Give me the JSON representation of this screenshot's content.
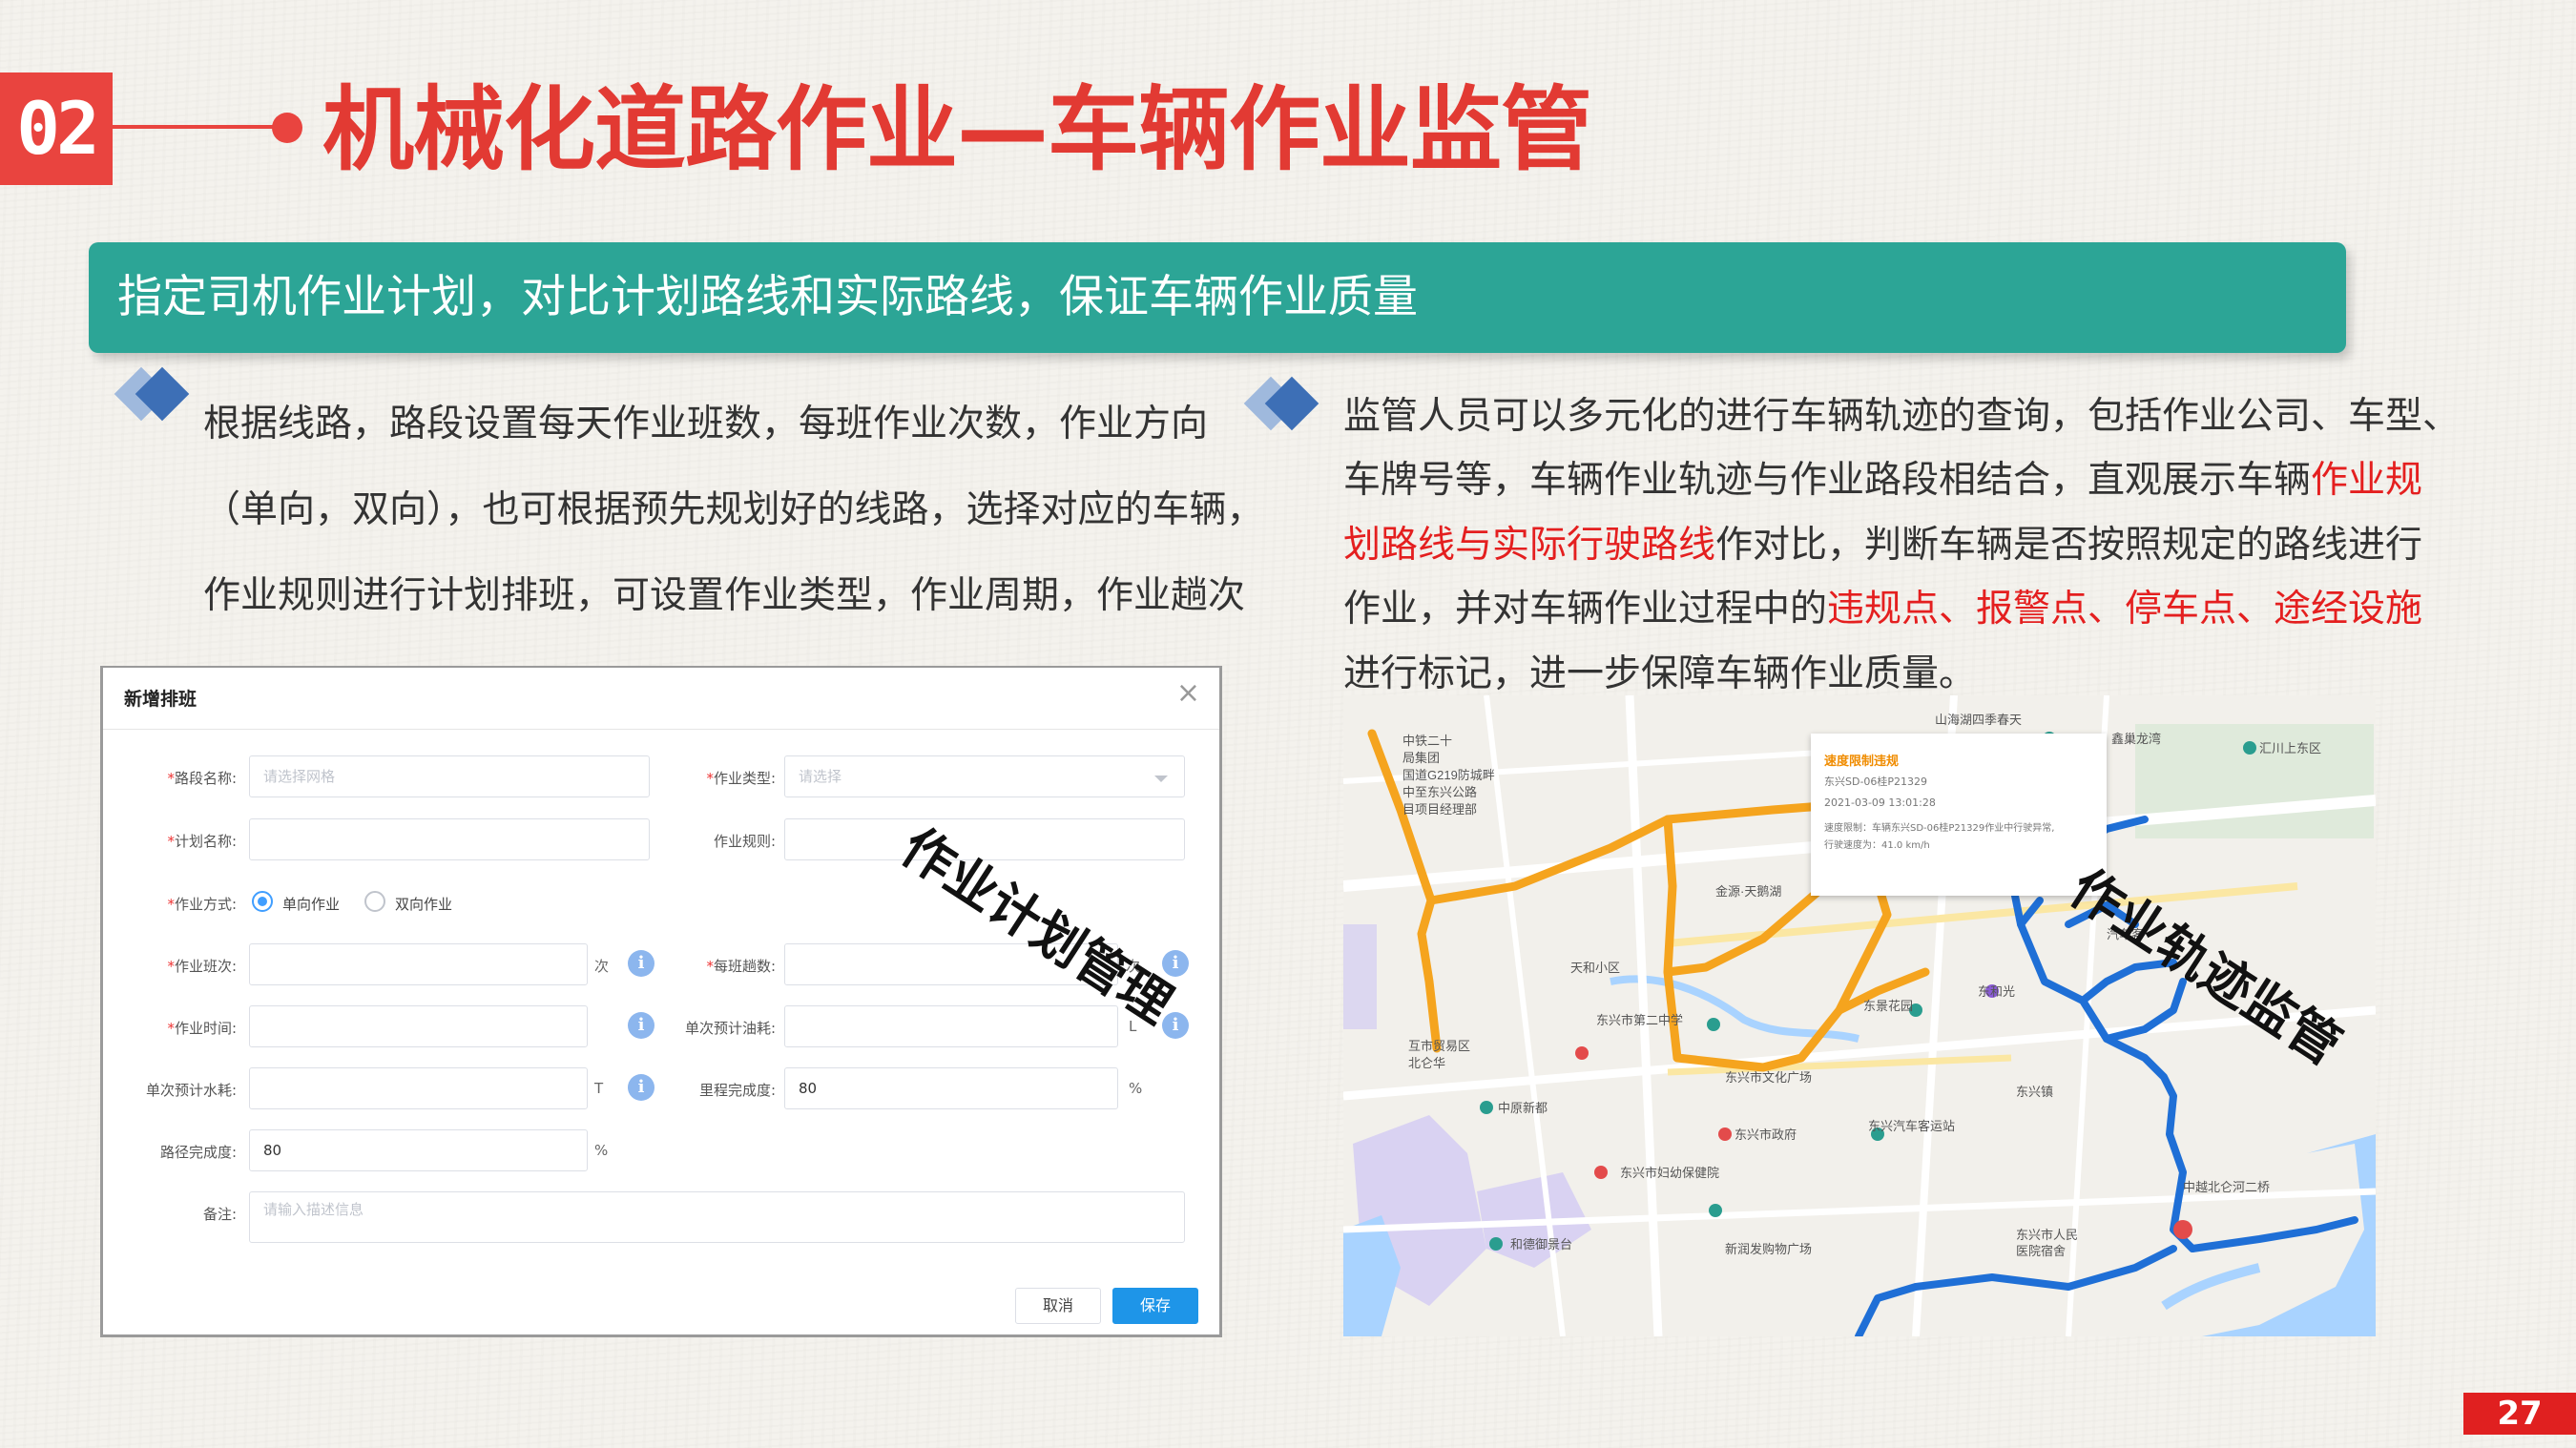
{
  "section": {
    "number": "02",
    "title": "机械化道路作业—车辆作业监管"
  },
  "banner": "指定司机作业计划，对比计划路线和实际路线，保证车辆作业质量",
  "left_text": {
    "line1": "根据线路，路段设置每天作业班数，每班作业次数，作业方向",
    "line2": "（单向，双向），也可根据预先规划好的线路，选择对应的车辆，",
    "line3": "作业规则进行计划排班，可设置作业类型，作业周期，作业趟次"
  },
  "right_text": {
    "line1": "监管人员可以多元化的进行车辆轨迹的查询，包括作业公司、车型、",
    "line2a": "车牌号等，车辆作业轨迹与作业路段相结合，直观展示车辆",
    "line2b": "作业规",
    "line3a": "划路线与实际行驶路线",
    "line3b": "作对比，判断车辆是否按照规定的路线进行",
    "line4a": "作业，并对车辆作业过程中的",
    "line4b": "违规点、报警点、停车点、途经设施",
    "line5": "进行标记，进一步保障车辆作业质量。"
  },
  "form": {
    "title": "新增排班",
    "close": "×",
    "road_label": "路段名称:",
    "road_placeholder": "请选择网格",
    "type_label": "作业类型:",
    "type_placeholder": "请选择",
    "plan_label": "计划名称:",
    "rule_label": "作业规则:",
    "mode_label": "作业方式:",
    "mode_one": "单向作业",
    "mode_two": "双向作业",
    "shift_label": "作业班次:",
    "shift_unit": "次",
    "trips_label": "每班趟数:",
    "trips_unit": "次",
    "time_label": "作业时间:",
    "fuel_label": "单次预计油耗:",
    "fuel_unit": "L",
    "water_label": "单次预计水耗:",
    "water_unit": "T",
    "mileage_label": "里程完成度:",
    "mileage_value": "80",
    "mileage_unit": "%",
    "path_label": "路径完成度:",
    "path_value": "80",
    "path_unit": "%",
    "note_label": "备注:",
    "note_placeholder": "请输入描述信息",
    "cancel": "取消",
    "save": "保存",
    "stamp": "作业计划管理"
  },
  "map": {
    "stamp": "作业轨迹监管",
    "popup": {
      "title": "速度限制违规",
      "plate": "东兴SD-06桂P21329",
      "time": "2021-03-09 13:01:28",
      "desc1": "速度限制：车辆东兴SD-06桂P21329作业中行驶异常,",
      "desc2": "行驶速度为：41.0 km/h"
    },
    "labels": [
      "山海湖四季春天",
      "鑫巢龙湾",
      "汇川上东区",
      "中铁二十",
      "局集团",
      "国道G219防城畔",
      "中至东兴公路",
      "目项目经理部",
      "金源·天鹅湖",
      "天和小区",
      "东景花园",
      "东和光",
      "东兴市第二中学",
      "东兴市文化广场",
      "互市贸易区",
      "北仑华",
      "中原新都",
      "东兴市政府",
      "东兴汽车客运站",
      "东兴镇",
      "东兴市妇幼保健院",
      "中越北仑河二桥",
      "和德御景台",
      "新润发购物广场",
      "东兴市人民",
      "医院宿舍",
      "汽车客"
    ],
    "colors": {
      "planned": "#f5a41e",
      "actual": "#1f6fd6"
    }
  },
  "page_number": "27"
}
